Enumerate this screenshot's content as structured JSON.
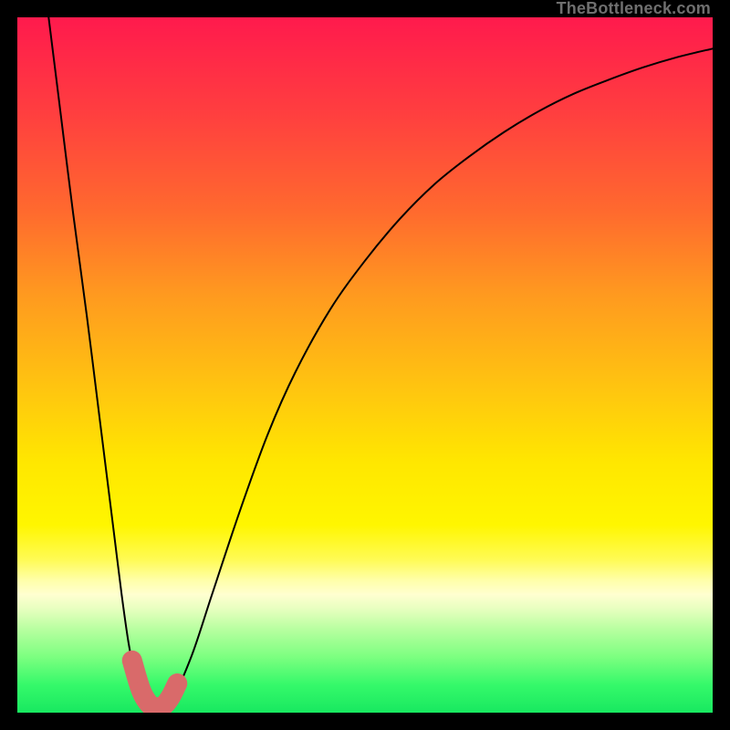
{
  "watermark": "TheBottleneck.com",
  "colors": {
    "frame": "#000000",
    "curve": "#000000",
    "marker": "#d96a6a",
    "gradient_top": "#ff1a4d",
    "gradient_bottom": "#18e860"
  },
  "chart_data": {
    "type": "line",
    "title": "",
    "xlabel": "",
    "ylabel": "",
    "xlim": [
      0,
      100
    ],
    "ylim": [
      0,
      100
    ],
    "series": [
      {
        "name": "bottleneck-curve",
        "x": [
          4.5,
          6,
          8,
          10,
          12,
          13,
          14,
          15,
          16,
          17,
          18,
          20,
          22,
          25,
          28,
          32,
          36,
          40,
          45,
          50,
          55,
          60,
          65,
          70,
          75,
          80,
          85,
          90,
          95,
          100
        ],
        "values": [
          100,
          88,
          72,
          57,
          41,
          33,
          25,
          17,
          10,
          5,
          2,
          0.5,
          1.5,
          8,
          17,
          29,
          40,
          49,
          58,
          65,
          71,
          76,
          80,
          83.5,
          86.5,
          89,
          91,
          92.8,
          94.3,
          95.5
        ]
      }
    ],
    "markers": [
      {
        "x": 16.5,
        "y": 7.5
      },
      {
        "x": 17.8,
        "y": 3.2
      },
      {
        "x": 19.0,
        "y": 1.2
      },
      {
        "x": 20.0,
        "y": 0.8
      },
      {
        "x": 21.0,
        "y": 1.0
      },
      {
        "x": 22.0,
        "y": 2.2
      },
      {
        "x": 23.0,
        "y": 4.2
      }
    ],
    "annotations": []
  }
}
